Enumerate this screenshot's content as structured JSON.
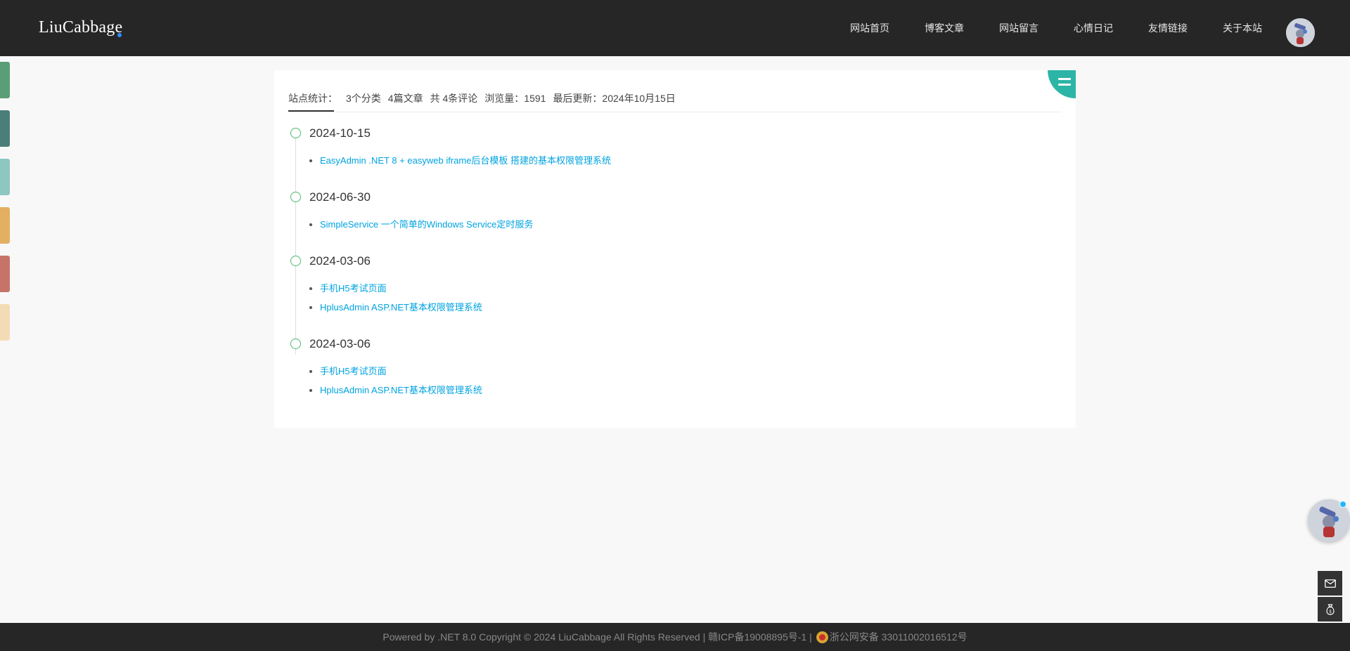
{
  "header": {
    "logo": "LiuCabbage",
    "nav": [
      "网站首页",
      "博客文章",
      "网站留言",
      "心情日记",
      "友情链接",
      "关于本站"
    ]
  },
  "side_tabs": [
    "#5a9e78",
    "#4b7e78",
    "#8cc7c0",
    "#e3b062",
    "#c67467",
    "#f3dcb5"
  ],
  "stats": {
    "label": "站点统计：",
    "categories": "3个分类",
    "articles": "4篇文章",
    "comments": "共 4条评论",
    "views": "浏览量：1591",
    "updated": "最后更新：2024年10月15日"
  },
  "timeline": [
    {
      "date": "2024-10-15",
      "items": [
        "EasyAdmin .NET 8 + easyweb iframe后台模板 搭建的基本权限管理系统"
      ]
    },
    {
      "date": "2024-06-30",
      "items": [
        "SimpleService 一个简单的Windows Service定时服务"
      ]
    },
    {
      "date": "2024-03-06",
      "items": [
        "手机H5考试页面",
        "HplusAdmin ASP.NET基本权限管理系统"
      ]
    },
    {
      "date": "2024-03-06",
      "items": [
        "手机H5考试页面",
        "HplusAdmin ASP.NET基本权限管理系统"
      ]
    }
  ],
  "footer": {
    "text": "Powered by .NET 8.0 Copyright © 2024 LiuCabbage All Rights Reserved | 赣ICP备19008895号-1 | ",
    "police": "浙公网安备 33011002016512号"
  },
  "tools": [
    "mail-icon",
    "money-bag-icon"
  ],
  "colors": {
    "accent": "#00a3e0",
    "teal": "#2cb5a6",
    "dark": "#262626",
    "dot": "#4cb86e"
  }
}
